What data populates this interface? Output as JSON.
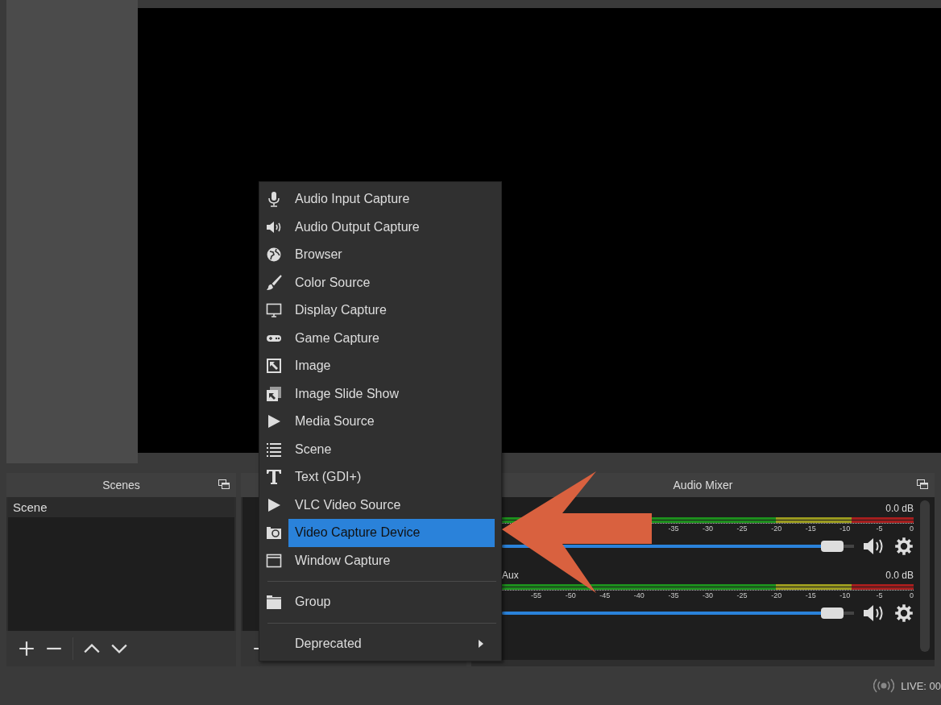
{
  "docks": {
    "scenes": {
      "title": "Scenes",
      "items": [
        {
          "label": "Scene",
          "selected": true
        }
      ]
    },
    "mixer": {
      "title": "Audio Mixer",
      "channels": [
        {
          "reading": "0.0 dB",
          "ticks": [
            "-35",
            "-30",
            "-25",
            "-20",
            "-15",
            "-10",
            "-5",
            "0"
          ],
          "level": 0.97
        },
        {
          "name": "Aux",
          "reading": "0.0 dB",
          "ticks": [
            "-55",
            "-50",
            "-45",
            "-40",
            "-35",
            "-30",
            "-25",
            "-20",
            "-15",
            "-10",
            "-5",
            "0"
          ],
          "level": 0.97
        }
      ]
    }
  },
  "context_menu": {
    "sections": [
      {
        "items": [
          {
            "label": "Audio Input Capture",
            "selected": false
          },
          {
            "label": "Audio Output Capture",
            "selected": false
          },
          {
            "label": "Browser",
            "selected": false
          },
          {
            "label": "Color Source",
            "selected": false
          },
          {
            "label": "Display Capture",
            "selected": false
          },
          {
            "label": "Game Capture",
            "selected": false
          },
          {
            "label": "Image",
            "selected": false
          },
          {
            "label": "Image Slide Show",
            "selected": false
          },
          {
            "label": "Media Source",
            "selected": false
          },
          {
            "label": "Scene",
            "selected": false
          },
          {
            "label": "Text (GDI+)",
            "selected": false
          },
          {
            "label": "VLC Video Source",
            "selected": false
          },
          {
            "label": "Video Capture Device",
            "selected": true
          },
          {
            "label": "Window Capture",
            "selected": false
          }
        ]
      },
      {
        "items": [
          {
            "label": "Group",
            "selected": false
          }
        ]
      },
      {
        "items": [
          {
            "label": "Deprecated",
            "selected": false,
            "submenu": true
          }
        ]
      }
    ]
  },
  "status_bar": {
    "live": "LIVE: 00"
  }
}
